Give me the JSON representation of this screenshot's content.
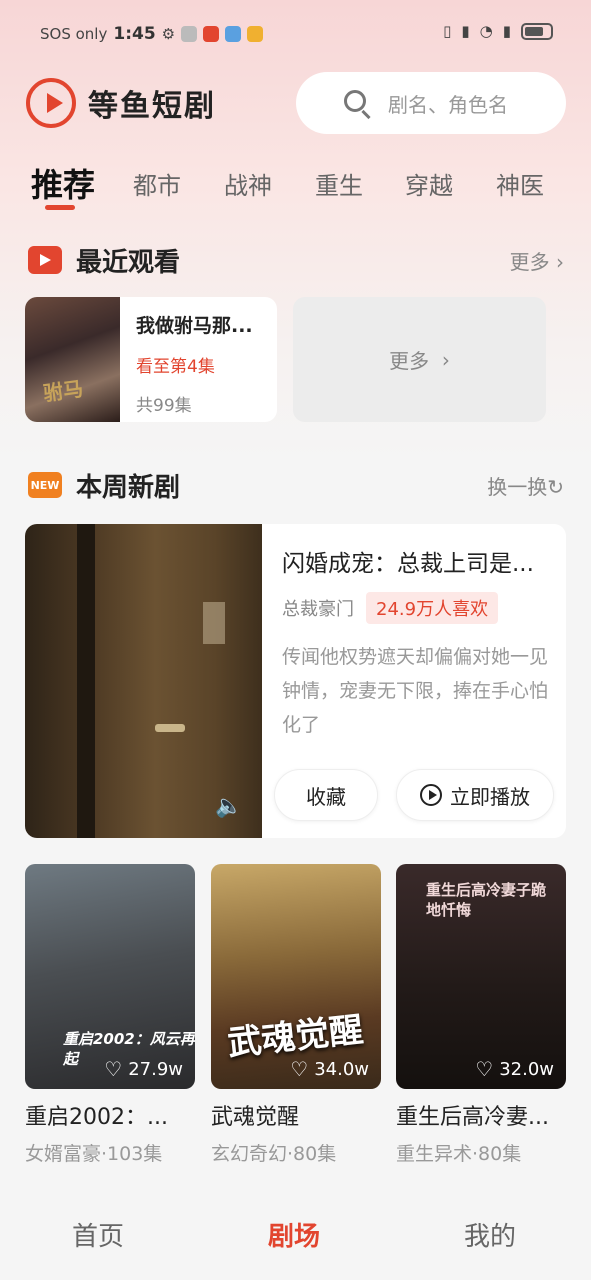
{
  "status_bar": {
    "carrier": "SOS only",
    "time": "1:45"
  },
  "header": {
    "app_name": "等鱼短剧",
    "search_placeholder": "剧名、角色名"
  },
  "tabs": [
    {
      "label": "推荐",
      "active": true
    },
    {
      "label": "都市",
      "active": false
    },
    {
      "label": "战神",
      "active": false
    },
    {
      "label": "重生",
      "active": false
    },
    {
      "label": "穿越",
      "active": false
    },
    {
      "label": "神医",
      "active": false
    }
  ],
  "recent": {
    "title": "最近观看",
    "more_label": "更多",
    "item": {
      "name": "我做驸马那...",
      "poster_text": "驸马",
      "progress": "看至第4集",
      "episodes": "共99集"
    },
    "more_card_label": "更多"
  },
  "weekly": {
    "title": "本周新剧",
    "refresh_label": "换一换",
    "badge": "NEW",
    "feature": {
      "title": "闪婚成宠：总裁上司是...",
      "genre": "总裁豪门",
      "likes": "24.9万人喜欢",
      "description": "传闻他权势遮天却偏偏对她一见钟情，宠妻无下限，捧在手心怕化了",
      "fav_label": "收藏",
      "play_label": "立即播放"
    }
  },
  "dramas": [
    {
      "name": "重启2002：...",
      "sub": "女婿富豪·103集",
      "likes": "27.9w",
      "poster_text": "重启2002：风云再起",
      "colors": [
        "#6f7a82",
        "#2a2a2c"
      ]
    },
    {
      "name": "武魂觉醒",
      "sub": "玄幻奇幻·80集",
      "likes": "34.0w",
      "poster_text": "武魂觉醒",
      "colors": [
        "#c8a868",
        "#3a2a1a"
      ]
    },
    {
      "name": "重生后高冷妻...",
      "sub": "重生异术·80集",
      "likes": "32.0w",
      "poster_text": "重生后高冷妻子跪地忏悔",
      "colors": [
        "#3a2a2a",
        "#14100e"
      ]
    }
  ],
  "bottom_nav": [
    {
      "label": "首页",
      "active": false
    },
    {
      "label": "剧场",
      "active": true
    },
    {
      "label": "我的",
      "active": false
    }
  ],
  "theme": {
    "accent": "#e2452f"
  }
}
